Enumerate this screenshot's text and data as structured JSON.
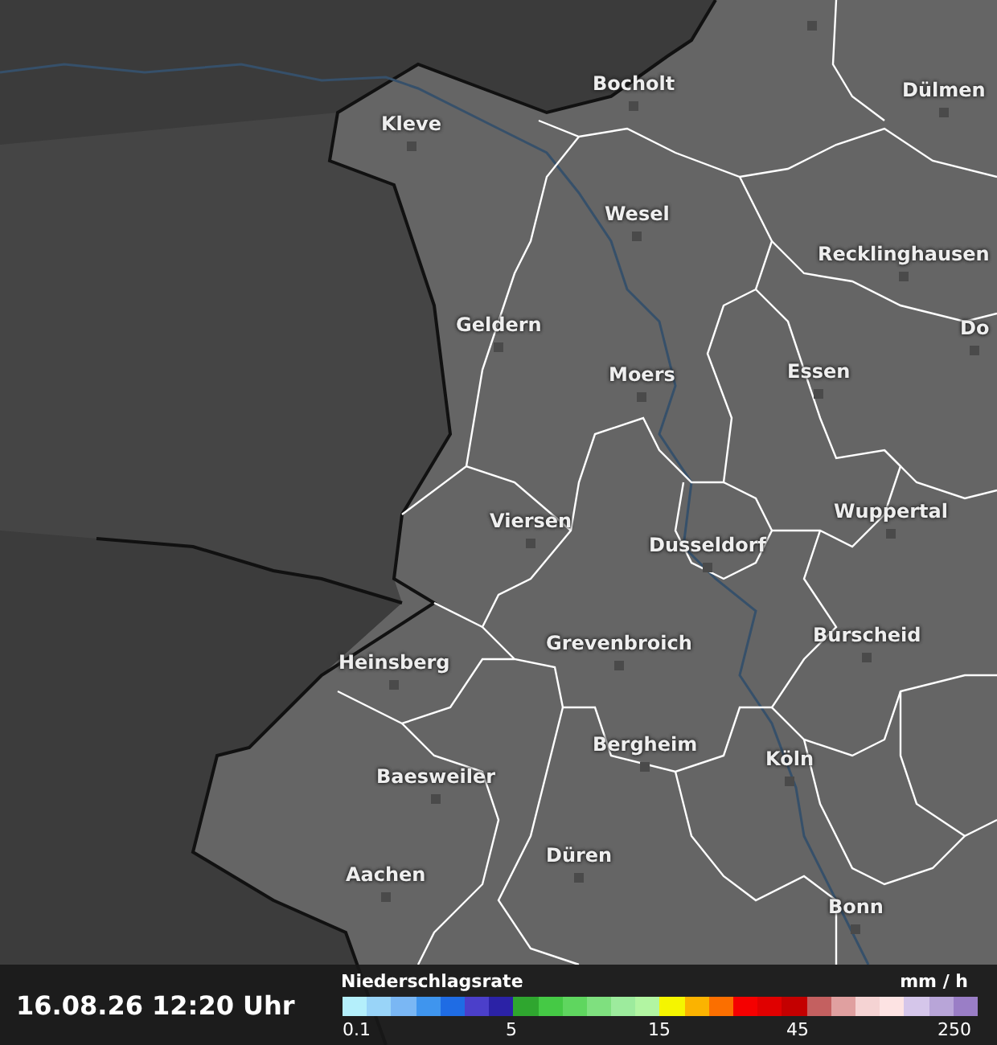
{
  "map": {
    "cities": [
      {
        "name": "Bocholt"
      },
      {
        "name": "Dülmen"
      },
      {
        "name": "Kleve"
      },
      {
        "name": "Wesel"
      },
      {
        "name": "Recklinghausen"
      },
      {
        "name": "Do"
      },
      {
        "name": "Geldern"
      },
      {
        "name": "Moers"
      },
      {
        "name": "Essen"
      },
      {
        "name": "Viersen"
      },
      {
        "name": "Wuppertal"
      },
      {
        "name": "Dusseldorf"
      },
      {
        "name": "Grevenbroich"
      },
      {
        "name": "Burscheid"
      },
      {
        "name": "Heinsberg"
      },
      {
        "name": "Bergheim"
      },
      {
        "name": "Köln"
      },
      {
        "name": "Baesweiler"
      },
      {
        "name": "Düren"
      },
      {
        "name": "Aachen"
      },
      {
        "name": "Bonn"
      }
    ]
  },
  "footer": {
    "timestamp": "16.08.26 12:20 Uhr",
    "legend": {
      "title": "Niederschlagsrate",
      "unit": "mm / h",
      "segments": [
        {
          "color": "#b4effb"
        },
        {
          "color": "#99d4f8"
        },
        {
          "color": "#7ab7f4"
        },
        {
          "color": "#3f95ee"
        },
        {
          "color": "#1f6ce4"
        },
        {
          "color": "#4b3fca"
        },
        {
          "color": "#2b22a6"
        },
        {
          "color": "#2fa62f"
        },
        {
          "color": "#45c945"
        },
        {
          "color": "#5fd65f"
        },
        {
          "color": "#7fe07f"
        },
        {
          "color": "#9deb9d"
        },
        {
          "color": "#b2f5a2"
        },
        {
          "color": "#f5f500"
        },
        {
          "color": "#fbb300"
        },
        {
          "color": "#fb6f00"
        },
        {
          "color": "#f50000"
        },
        {
          "color": "#e00000"
        },
        {
          "color": "#c40000"
        },
        {
          "color": "#c46060"
        },
        {
          "color": "#e0a0a0"
        },
        {
          "color": "#f5d3d3"
        },
        {
          "color": "#fde3e3"
        },
        {
          "color": "#d5c6ea"
        },
        {
          "color": "#b8a5d8"
        },
        {
          "color": "#9a7ec6"
        }
      ],
      "ticks": [
        "0.1",
        "5",
        "15",
        "45",
        "250"
      ]
    }
  }
}
